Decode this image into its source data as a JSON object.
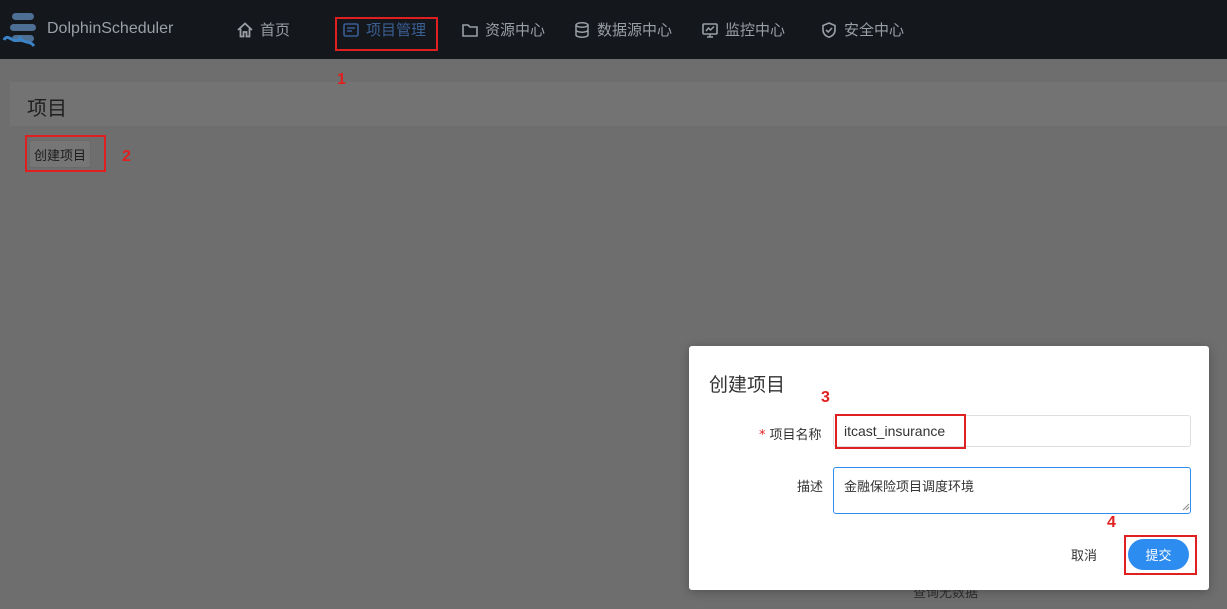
{
  "topbar": {
    "brand": "DolphinScheduler",
    "nav": [
      {
        "label": "首页",
        "icon": "home-icon"
      },
      {
        "label": "项目管理",
        "icon": "project-icon",
        "active": true
      },
      {
        "label": "资源中心",
        "icon": "folder-icon"
      },
      {
        "label": "数据源中心",
        "icon": "database-icon"
      },
      {
        "label": "监控中心",
        "icon": "monitor-icon"
      },
      {
        "label": "安全中心",
        "icon": "shield-icon"
      }
    ]
  },
  "page": {
    "title": "项目",
    "create_button": "创建项目",
    "empty_text": "查询无数据"
  },
  "modal": {
    "title": "创建项目",
    "name_label": "项目名称",
    "name_required_mark": "*",
    "name_value": "itcast_insurance",
    "desc_label": "描述",
    "desc_value": "金融保险项目调度环境",
    "cancel_label": "取消",
    "submit_label": "提交"
  },
  "annotations": {
    "numbers": [
      "1",
      "2",
      "3",
      "4"
    ],
    "color": "#e02020"
  },
  "colors": {
    "topbar_bg": "#14171c",
    "overlay_bg": "#6e6e6e",
    "accent": "#2d8cf0",
    "active_nav": "#3a5f93"
  }
}
